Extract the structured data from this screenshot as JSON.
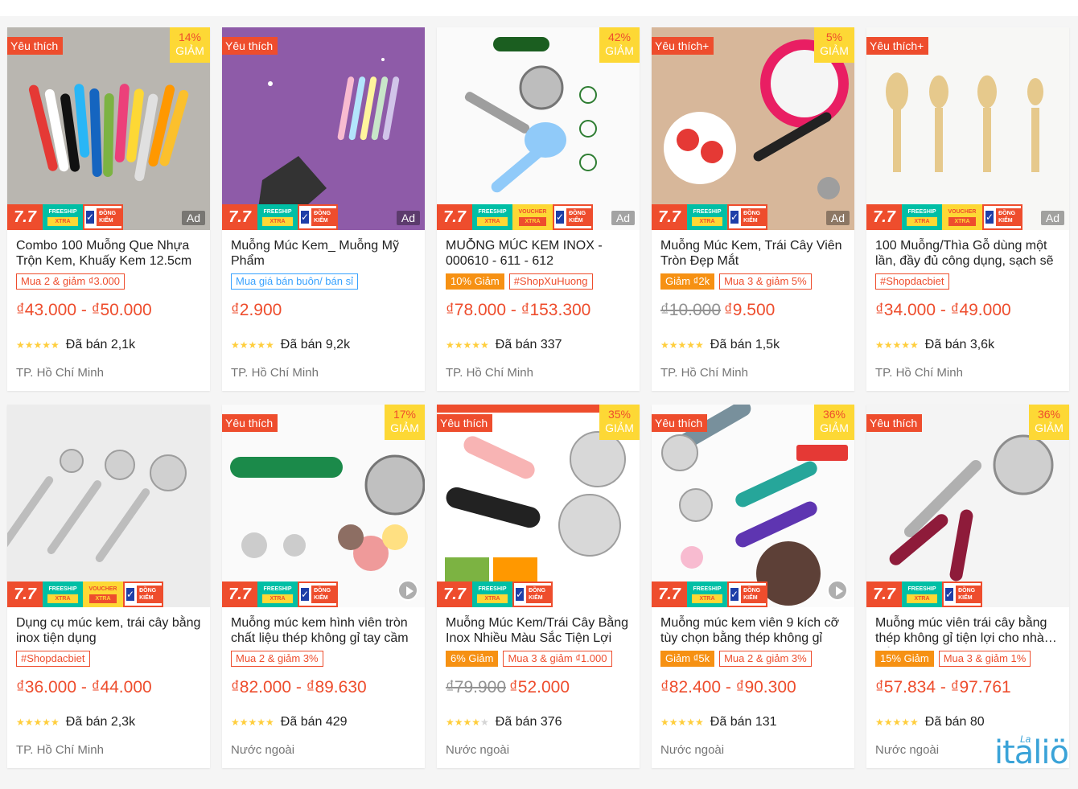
{
  "colors": {
    "brand": "#ee4d2d",
    "star": "#ffce3d",
    "badge_yellow": "#fdd835",
    "watermark": "#3aa3d8"
  },
  "labels": {
    "promo_77": "7.7",
    "freeship": "FREESHIP",
    "xtra": "XTRA",
    "voucher": "VOUCHER",
    "dong_kiem": "ĐỒNG KIỂM",
    "giam": "GIẢM",
    "ad": "Ad"
  },
  "watermark": {
    "logo": "italiö",
    "signature": "La"
  },
  "products": [
    {
      "badge": "Yêu thích",
      "discount": "14%",
      "name": "Combo 100 Muỗng Que Nhựa Trộn Kem, Khuấy Kem 12.5cm",
      "tags": [
        {
          "text": "Mua 2 & giảm ₫3.000",
          "style": "outline"
        }
      ],
      "old_price": "",
      "price": "₫43.000 - ₫50.000",
      "rating": 5,
      "sold": "Đã bán 2,1k",
      "location": "TP. Hồ Chí Minh",
      "ad": true,
      "video": false,
      "img_icon": "plastic-spoons-image"
    },
    {
      "badge": "Yêu thích",
      "discount": "",
      "name": "Muỗng Múc Kem_ Muỗng Mỹ Phẩm",
      "tags": [
        {
          "text": "Mua giá bán buôn/ bán sỉ",
          "style": "blue"
        }
      ],
      "old_price": "",
      "price": "₫2.900",
      "rating": 5,
      "sold": "Đã bán 9,2k",
      "location": "TP. Hồ Chí Minh",
      "ad": true,
      "video": false,
      "img_icon": "cosmetic-spoons-image"
    },
    {
      "badge": "",
      "discount": "42%",
      "name": "MUỖNG MÚC KEM INOX - 000610 - 611 - 612",
      "tags": [
        {
          "text": "10% Giảm",
          "style": "fill"
        },
        {
          "text": "#ShopXuHuong",
          "style": "outline"
        }
      ],
      "old_price": "",
      "price": "₫78.000 - ₫153.300",
      "rating": 5,
      "sold": "Đã bán 337",
      "location": "TP. Hồ Chí Minh",
      "ad": true,
      "video": false,
      "img_icon": "inox-scoops-image"
    },
    {
      "badge": "Yêu thích+",
      "discount": "5%",
      "name": "Muỗng Múc Kem, Trái Cây Viên Tròn Đẹp Mắt",
      "tags": [
        {
          "text": "Giảm ₫2k",
          "style": "fill"
        },
        {
          "text": "Mua 3 & giảm 5%",
          "style": "outline"
        }
      ],
      "old_price": "₫10.000",
      "price": "₫9.500",
      "rating": 5,
      "sold": "Đã bán 1,5k",
      "location": "TP. Hồ Chí Minh",
      "ad": true,
      "video": false,
      "img_icon": "melon-baller-image"
    },
    {
      "badge": "Yêu thích+",
      "discount": "",
      "name": "100 Muỗng/Thìa Gỗ dùng một lần, đầy đủ công dụng, sạch sẽ",
      "tags": [
        {
          "text": "#Shopdacbiet",
          "style": "outline"
        }
      ],
      "old_price": "",
      "price": "₫34.000 - ₫49.000",
      "rating": 5,
      "sold": "Đã bán 3,6k",
      "location": "TP. Hồ Chí Minh",
      "ad": true,
      "video": false,
      "img_icon": "wooden-spoons-image"
    },
    {
      "badge": "",
      "discount": "",
      "name": "Dụng cụ múc kem, trái cây bằng inox tiện dụng",
      "tags": [
        {
          "text": "#Shopdacbiet",
          "style": "outline"
        }
      ],
      "old_price": "",
      "price": "₫36.000 - ₫44.000",
      "rating": 5,
      "sold": "Đã bán 2,3k",
      "location": "TP. Hồ Chí Minh",
      "ad": false,
      "video": false,
      "img_icon": "three-scoops-image"
    },
    {
      "badge": "Yêu thích",
      "discount": "17%",
      "name": "Muỗng múc kem hình viên tròn chất liệu thép không gỉ tay cầm",
      "tags": [
        {
          "text": "Mua 2 & giảm 3%",
          "style": "outline"
        }
      ],
      "old_price": "",
      "price": "₫82.000 - ₫89.630",
      "rating": 5,
      "sold": "Đã bán 429",
      "location": "Nước ngoài",
      "ad": false,
      "video": true,
      "img_icon": "green-scoop-image"
    },
    {
      "badge": "Yêu thích",
      "discount": "35%",
      "name": "Muỗng Múc Kem/Trái Cây Bằng Inox Nhiều Màu Sắc Tiện Lợi",
      "tags": [
        {
          "text": "6% Giảm",
          "style": "fill"
        },
        {
          "text": "Mua 3 & giảm ₫1.000",
          "style": "outline"
        }
      ],
      "old_price": "₫79.900",
      "price": "₫52.000",
      "rating": 4,
      "sold": "Đã bán 376",
      "location": "Nước ngoài",
      "ad": false,
      "video": false,
      "img_icon": "pink-black-scoops-image"
    },
    {
      "badge": "Yêu thích",
      "discount": "36%",
      "name": "Muỗng múc kem viên 9 kích cỡ tùy chọn bằng thép không gỉ",
      "tags": [
        {
          "text": "Giảm ₫5k",
          "style": "fill"
        },
        {
          "text": "Mua 2 & giảm 3%",
          "style": "outline"
        }
      ],
      "old_price": "",
      "price": "₫82.400 - ₫90.300",
      "rating": 5,
      "sold": "Đã bán 131",
      "location": "Nước ngoài",
      "ad": false,
      "video": true,
      "img_icon": "nine-sizes-scoops-image"
    },
    {
      "badge": "Yêu thích",
      "discount": "36%",
      "name": "Muỗng múc viên trái cây bằng thép không gỉ tiện lợi cho nhà bếp",
      "tags": [
        {
          "text": "15% Giảm",
          "style": "fill"
        },
        {
          "text": "Mua 3 & giảm 1%",
          "style": "outline"
        }
      ],
      "old_price": "",
      "price": "₫57.834 - ₫97.761",
      "rating": 5,
      "sold": "Đã bán 80",
      "location": "Nước ngoài",
      "ad": false,
      "video": false,
      "img_icon": "red-scoop-image"
    }
  ]
}
